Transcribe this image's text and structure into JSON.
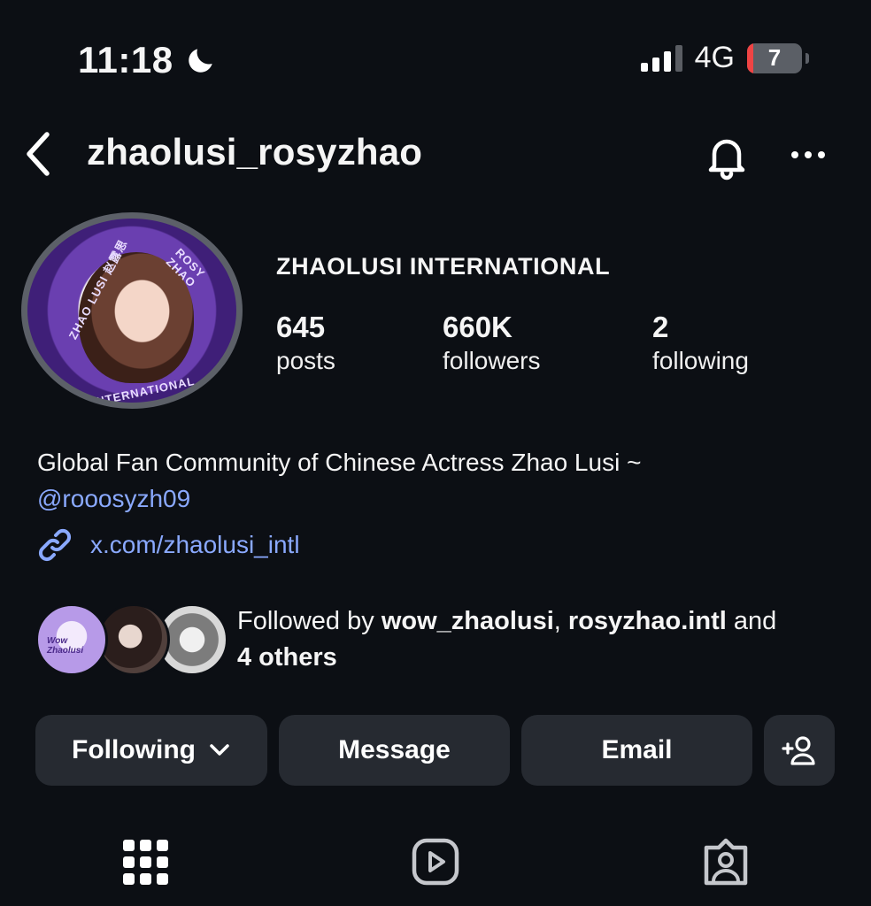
{
  "status_bar": {
    "time": "11:18",
    "focus_icon": "moon-icon",
    "network": "4G",
    "battery_level": "7",
    "battery_color": "#ef4444"
  },
  "header": {
    "back_icon": "chevron-left-icon",
    "username": "zhaolusi_rosyzhao",
    "bell_icon": "bell-icon",
    "more_icon": "more-dots-icon"
  },
  "profile": {
    "avatar_text_left": "ZHAO LUSI 赵露思",
    "avatar_text_right": "ROSY ZHAO",
    "avatar_text_bottom": "INTERNATIONAL",
    "display_name": "ZHAOLUSI INTERNATIONAL",
    "stats": [
      {
        "value": "645",
        "label": "posts"
      },
      {
        "value": "660K",
        "label": "followers"
      },
      {
        "value": "2",
        "label": "following"
      }
    ],
    "bio": "Global Fan Community of Chinese Actress Zhao Lusi ~",
    "mention": "@rooosyzh09",
    "link": "x.com/zhaolusi_intl",
    "link_color": "#8aa9ff"
  },
  "followed_by": {
    "prefix": "Followed by",
    "user1": "wow_zhaolusi",
    "separator": ",",
    "user2": "rosyzhao.intl",
    "conjunction": "and",
    "others": "4 others",
    "mutual1_text": "Wow Zhaolusi"
  },
  "actions": {
    "following_label": "Following",
    "message_label": "Message",
    "email_label": "Email",
    "add_user_icon": "add-user-icon"
  },
  "tabs": [
    {
      "icon": "grid-icon"
    },
    {
      "icon": "reels-icon"
    },
    {
      "icon": "tagged-icon"
    }
  ]
}
